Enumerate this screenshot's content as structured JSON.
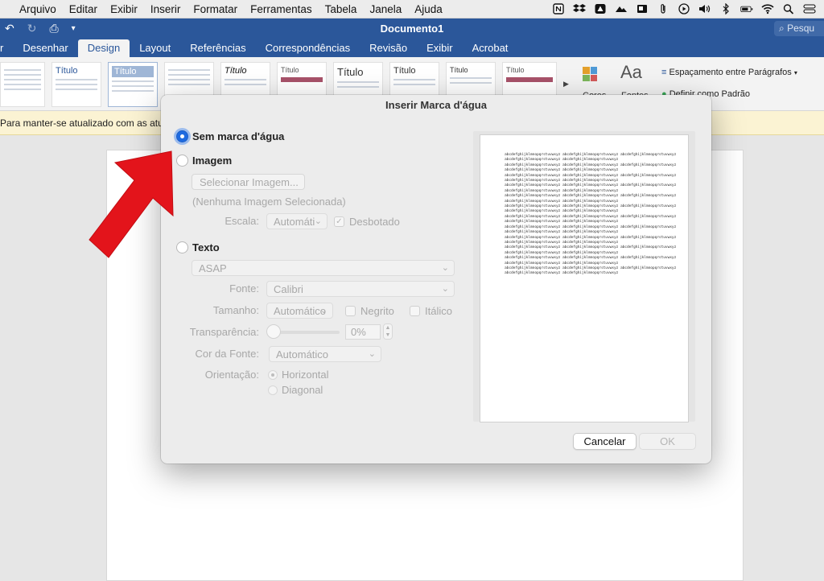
{
  "menubar": {
    "items": [
      "Arquivo",
      "Editar",
      "Exibir",
      "Inserir",
      "Formatar",
      "Ferramentas",
      "Tabela",
      "Janela",
      "Ajuda"
    ],
    "status_icons": [
      "notion-icon",
      "dropbox-icon",
      "app-icon",
      "cloud-icon",
      "drive-icon",
      "paperclip-icon",
      "play-icon",
      "volume-icon",
      "bluetooth-icon",
      "battery-icon",
      "wifi-icon",
      "search-icon",
      "control-center-icon"
    ]
  },
  "window": {
    "title": "Documento1",
    "search_placeholder": "Pesqu"
  },
  "ribbon": {
    "tabs": [
      "r",
      "Desenhar",
      "Design",
      "Layout",
      "Referências",
      "Correspondências",
      "Revisão",
      "Exibir",
      "Acrobat"
    ],
    "active_tab": "Design",
    "style_thumbs": [
      "",
      "Título",
      "Título",
      "",
      "Título",
      "Título",
      "Título",
      "Título",
      "Título",
      "Título"
    ],
    "colors_label": "Cores",
    "fonts_label": "Fontes",
    "fonts_glyph": "Aa",
    "spacing_label": "Espaçamento entre Parágrafos",
    "default_label": "Definir como Padrão"
  },
  "infobar": {
    "text": "Para manter-se atualizado com as atu"
  },
  "dialog": {
    "title": "Inserir Marca d'água",
    "options": {
      "none": "Sem marca d'água",
      "image": "Imagem",
      "text": "Texto"
    },
    "select_image_button": "Selecionar Imagem...",
    "no_image_text": "(Nenhuma Imagem Selecionada)",
    "scale_label": "Escala:",
    "scale_value": "Automáti",
    "washout_label": "Desbotado",
    "text_value": "ASAP",
    "font_label": "Fonte:",
    "font_value": "Calibri",
    "size_label": "Tamanho:",
    "size_value": "Automático",
    "bold_label": "Negrito",
    "italic_label": "Itálico",
    "transparency_label": "Transparência:",
    "transparency_value": "0%",
    "font_color_label": "Cor da Fonte:",
    "font_color_value": "Automático",
    "orientation_label": "Orientação:",
    "orientation_horizontal": "Horizontal",
    "orientation_diagonal": "Diagonal",
    "preview_line": "abcdefghijklmnopqrstuvwxyz abcdefghijklmnopqrstuvwxyz abcdefghijklmnopqrstuvwxyz",
    "preview_line_short": "abcdefghijklmnopqrstuvwxyz abcdefghijklmnopqrstuvwxyz",
    "cancel_label": "Cancelar",
    "ok_label": "OK"
  },
  "colors": {
    "word_blue": "#2b579a",
    "radio_selected": "#1e6ae0",
    "annotation_arrow": "#e3141b"
  }
}
